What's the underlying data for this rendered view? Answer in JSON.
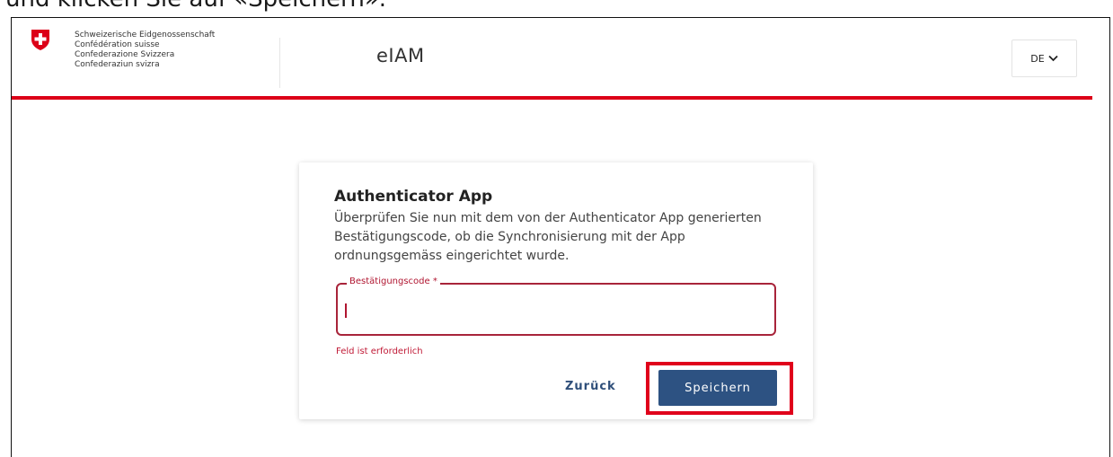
{
  "instruction_text": "und klicken Sie auf «Speichern».",
  "header": {
    "logo_lines": [
      "Schweizerische Eidgenossenschaft",
      "Confédération suisse",
      "Confederazione Svizzera",
      "Confederaziun svizra"
    ],
    "app_name": "eIAM",
    "language": "DE",
    "brand_color": "#dc0018"
  },
  "card": {
    "title": "Authenticator App",
    "description": "Überprüfen Sie nun mit dem von der Authenticator App generierten Bestätigungscode, ob die Synchronisierung mit der App ordnungsgemäss eingerichtet wurde.",
    "field": {
      "label": "Bestätigungscode *",
      "value": "",
      "error": "Feld ist erforderlich",
      "error_color": "#c01a36"
    },
    "back_label": "Zurück",
    "save_label": "Speichern",
    "save_color": "#2d5282",
    "highlight_color": "#e0001b"
  }
}
